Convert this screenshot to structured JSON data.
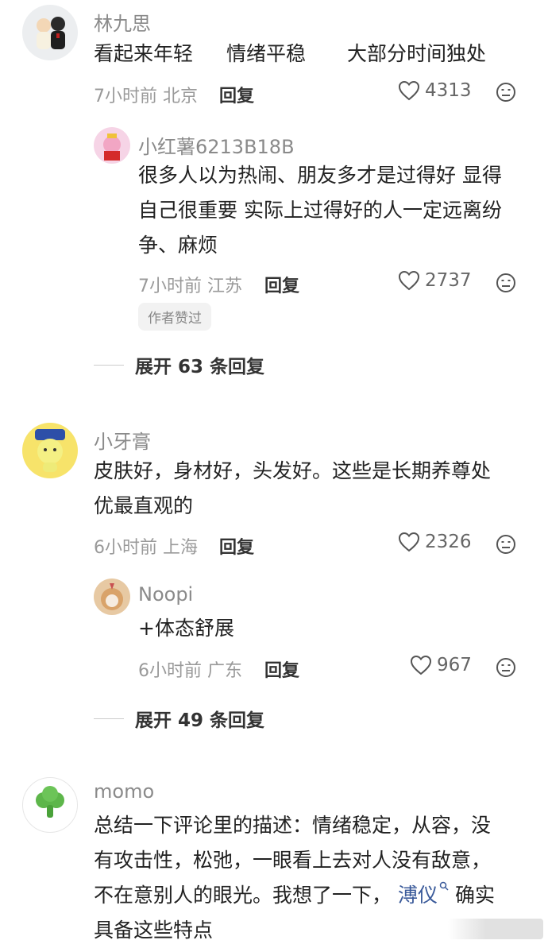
{
  "comments": [
    {
      "user": "林九思",
      "text_parts": [
        "看起来年轻",
        "情绪平稳",
        "大部分时间独处"
      ],
      "time": "7小时前",
      "location": "北京",
      "reply_label": "回复",
      "likes": "4313",
      "reply": {
        "user": "小红薯6213B18B",
        "lines": [
          "很多人以为热闹、朋友多才是过得好 显得",
          "自己很重要 实际上过得好的人一定远离纷",
          "争、麻烦"
        ],
        "time": "7小时前",
        "location": "江苏",
        "reply_label": "回复",
        "likes": "2737",
        "badge": "作者赞过"
      },
      "expand_label": "展开 63 条回复"
    },
    {
      "user": "小牙膏",
      "lines": [
        "皮肤好，身材好，头发好。这些是长期养尊处",
        "优最直观的"
      ],
      "time": "6小时前",
      "location": "上海",
      "reply_label": "回复",
      "likes": "2326",
      "reply": {
        "user": "Noopi",
        "lines": [
          "+体态舒展"
        ],
        "time": "6小时前",
        "location": "广东",
        "reply_label": "回复",
        "likes": "967"
      },
      "expand_label": "展开 49 条回复"
    },
    {
      "user": "momo",
      "lines": [
        "总结一下评论里的描述：情绪稳定，从容，没",
        "有攻击性，松弛，一眼看上去对人没有敌意，"
      ],
      "line3_before": "不在意别人的眼光。我想了一下，",
      "line3_link": "溥仪",
      "line3_after": "确实",
      "line4": "具备这些特点"
    }
  ],
  "colors": {
    "link": "#3a5a9a",
    "meta": "#9a9a9a",
    "username": "#8a8a8a"
  }
}
